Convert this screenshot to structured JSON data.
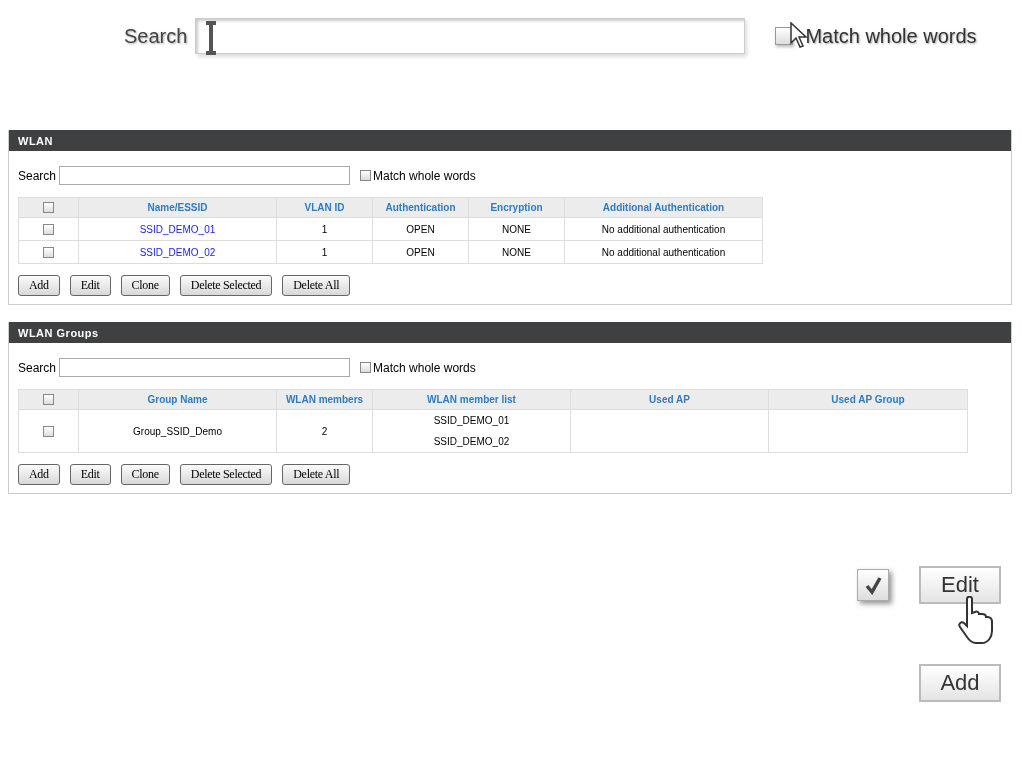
{
  "zoom_search": {
    "label": "Search",
    "match_label": "Match whole words",
    "match_checked": false
  },
  "panels": [
    {
      "title": "WLAN",
      "search_label": "Search",
      "match_label": "Match whole words",
      "match_checked": false,
      "all_selected": false,
      "columns": [
        {
          "label": "Name/ESSID",
          "kind": "link"
        },
        {
          "label": "VLAN ID",
          "kind": "text"
        },
        {
          "label": "Authentication",
          "kind": "text"
        },
        {
          "label": "Encryption",
          "kind": "text"
        },
        {
          "label": "Additional Authentication",
          "kind": "text"
        }
      ],
      "rows": [
        {
          "selected": false,
          "cells": [
            [
              "SSID_DEMO_01"
            ],
            [
              "1"
            ],
            [
              "OPEN"
            ],
            [
              "NONE"
            ],
            [
              "No additional authentication"
            ]
          ]
        },
        {
          "selected": false,
          "cells": [
            [
              "SSID_DEMO_02"
            ],
            [
              "1"
            ],
            [
              "OPEN"
            ],
            [
              "NONE"
            ],
            [
              "No additional authentication"
            ]
          ]
        }
      ],
      "buttons": [
        "Add",
        "Edit",
        "Clone",
        "Delete Selected",
        "Delete All"
      ]
    },
    {
      "title": "WLAN Groups",
      "search_label": "Search",
      "match_label": "Match whole words",
      "match_checked": false,
      "all_selected": false,
      "columns": [
        {
          "label": "Group Name",
          "kind": "text"
        },
        {
          "label": "WLAN members",
          "kind": "text"
        },
        {
          "label": "WLAN member list",
          "kind": "text"
        },
        {
          "label": "Used AP",
          "kind": "text"
        },
        {
          "label": "Used AP Group",
          "kind": "text"
        }
      ],
      "rows": [
        {
          "selected": false,
          "cells": [
            [
              "Group_SSID_Demo"
            ],
            [
              "2"
            ],
            [
              "SSID_DEMO_01",
              "SSID_DEMO_02"
            ],
            [],
            []
          ]
        }
      ],
      "buttons": [
        "Add",
        "Edit",
        "Clone",
        "Delete Selected",
        "Delete All"
      ]
    }
  ],
  "callouts": {
    "checked": true,
    "buttons": [
      "Edit",
      "Add"
    ]
  }
}
